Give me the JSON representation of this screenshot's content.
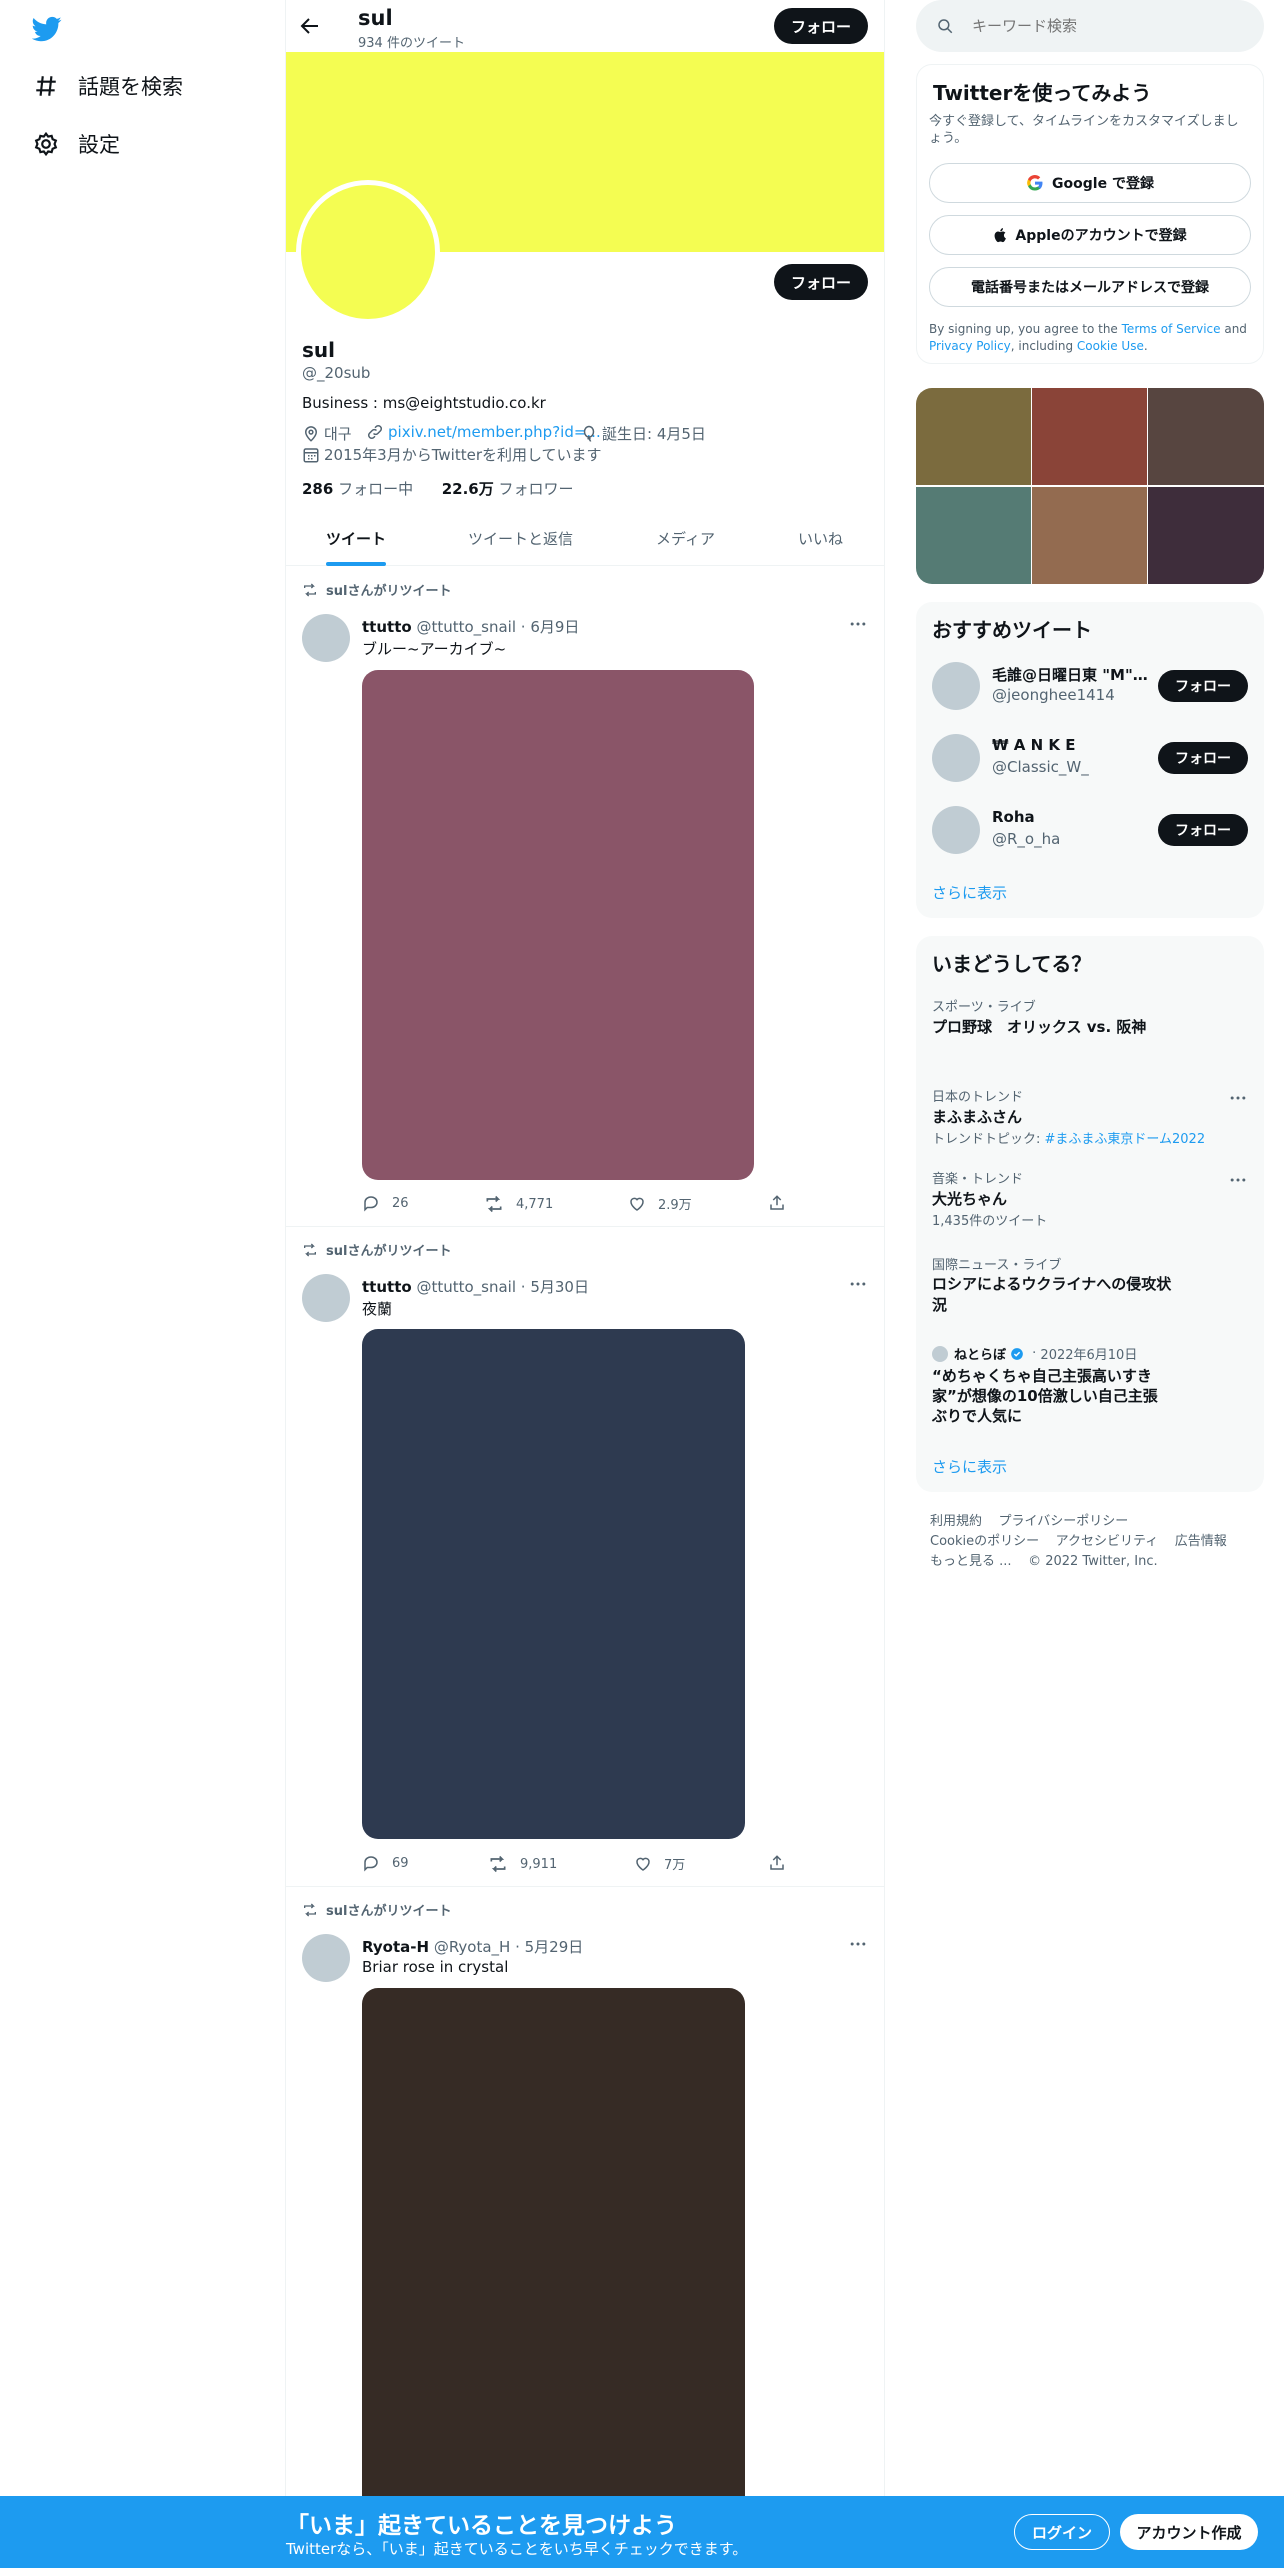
{
  "nav": {
    "explore_label": "話題を検索",
    "settings_label": "設定"
  },
  "header": {
    "name": "sul",
    "tweet_count": "934 件のツイート",
    "follow_label": "フォロー"
  },
  "profile": {
    "name": "sul",
    "handle": "@_20sub",
    "bio": "Business : ms@eightstudio.co.kr",
    "location": "대구",
    "link": "pixiv.net/member.php?id=...",
    "birthday": "誕生日: 4月5日",
    "joined": "2015年3月からTwitterを利用しています",
    "following_count": "286",
    "following_label": "フォロー中",
    "followers_count": "22.6万",
    "followers_label": "フォロワー",
    "follow_label": "フォロー",
    "banner_color": "#f4fd52"
  },
  "tabs": [
    "ツイート",
    "ツイートと返信",
    "メディア",
    "いいね"
  ],
  "tweets": [
    {
      "retweet_label": "sulさんがリツイート",
      "author": "ttutto",
      "handle": "@ttutto_snail",
      "date": "6月9日",
      "text": "ブルー~アーカイブ~",
      "media_color": "#8a5568",
      "replies": "26",
      "retweets": "4,771",
      "likes": "2.9万"
    },
    {
      "retweet_label": "sulさんがリツイート",
      "author": "ttutto",
      "handle": "@ttutto_snail",
      "date": "5月30日",
      "text": "夜蘭",
      "media_color": "#2e3a50",
      "replies": "69",
      "retweets": "9,911",
      "likes": "7万"
    },
    {
      "retweet_label": "sulさんがリツイート",
      "author": "Ryota-H",
      "handle": "@Ryota_H",
      "date": "5月29日",
      "text": "Briar rose in crystal",
      "media_color": "#362b25"
    }
  ],
  "search": {
    "placeholder": "キーワード検索"
  },
  "signup": {
    "title": "Twitterを使ってみよう",
    "subtitle": "今すぐ登録して、タイムラインをカスタマイズしましょう。",
    "google": "Google で登録",
    "apple": "Appleのアカウントで登録",
    "phone": "電話番号またはメールアドレスで登録",
    "terms_pre": "By signing up, you agree to the ",
    "terms_link": "Terms of Service",
    "terms_and": " and ",
    "privacy_link": "Privacy Policy",
    "terms_inc": ", including ",
    "cookie_link": "Cookie Use",
    "terms_end": "."
  },
  "media_grid": [
    "#7b6b3e",
    "#8a4438",
    "#574540",
    "#557b74",
    "#936b50",
    "#3e2d3b"
  ],
  "suggestions": {
    "title": "おすすめツイート",
    "users": [
      {
        "name": "毛誰@日曜日東 \"M\"-...",
        "handle": "@jeonghee1414",
        "button": "フォロー"
      },
      {
        "name": "₩ A N K E",
        "handle": "@Classic_W_",
        "button": "フォロー"
      },
      {
        "name": "Roha",
        "handle": "@R_o_ha",
        "button": "フォロー"
      }
    ],
    "more": "さらに表示"
  },
  "trends": {
    "title": "いまどうしてる？",
    "items": [
      {
        "category": "スポーツ・ライブ",
        "name": "プロ野球　オリックス vs. 阪神"
      },
      {
        "category": "日本のトレンド",
        "name": "まふまふさん",
        "sub_pre": "トレンドトピック: ",
        "sub_link": "#まふまふ東京ドーム2022"
      },
      {
        "category": "音楽・トレンド",
        "name": "大光ちゃん",
        "sub": "1,435件のツイート"
      },
      {
        "category": "国際ニュース・ライブ",
        "name": "ロシアによるウクライナへの侵攻状況"
      }
    ],
    "news": {
      "source": "ねとらぼ",
      "date": "2022年6月10日",
      "title": "“めちゃくちゃ自己主張高いすき家”が想像の10倍激しい自己主張ぶりで人気に"
    },
    "more": "さらに表示"
  },
  "footer": {
    "terms": "利用規約",
    "privacy": "プライバシーポリシー",
    "cookie": "Cookieのポリシー",
    "accessibility": "アクセシビリティ",
    "ads": "広告情報",
    "more": "もっと見る ...",
    "copyright": "© 2022 Twitter, Inc."
  },
  "bottom_bar": {
    "title": "「いま」起きていることを見つけよう",
    "subtitle": "Twitterなら、「いま」起きていることをいち早くチェックできます。",
    "login": "ログイン",
    "signup": "アカウント作成"
  }
}
